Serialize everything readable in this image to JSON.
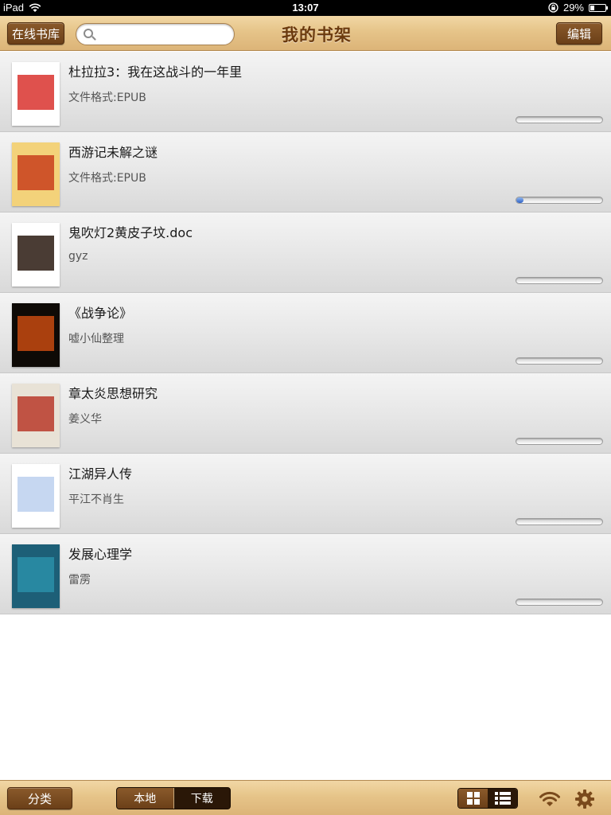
{
  "status": {
    "device": "iPad",
    "time": "13:07",
    "battery": "29%",
    "battery_level": 0.29
  },
  "header": {
    "online_library_label": "在线书库",
    "search_placeholder": "",
    "title": "我的书架",
    "edit_label": "编辑"
  },
  "books": [
    {
      "title": "杜拉拉3：我在这战斗的一年里",
      "subtitle": "文件格式:EPUB",
      "progress": 0.0,
      "cover_color": "#d9322e",
      "cover_bg": "#ffffff"
    },
    {
      "title": "西游记未解之谜",
      "subtitle": "文件格式:EPUB",
      "progress": 0.08,
      "cover_color": "#c8401c",
      "cover_bg": "#f3d27a"
    },
    {
      "title": "鬼吹灯2黄皮子坟.doc",
      "subtitle": "gyz",
      "progress": 0.0,
      "cover_color": "#2a1a10",
      "cover_bg": "#ffffff"
    },
    {
      "title": "《战争论》",
      "subtitle": "嘘小仙整理",
      "progress": 0.0,
      "cover_color": "#c64a10",
      "cover_bg": "#0e0a06"
    },
    {
      "title": "章太炎思想研究",
      "subtitle": "姜义华",
      "progress": 0.0,
      "cover_color": "#b83a2a",
      "cover_bg": "#e8e2d6"
    },
    {
      "title": "江湖异人传",
      "subtitle": "平江不肖生",
      "progress": 0.0,
      "cover_color": "#bcd0ee",
      "cover_bg": "#ffffff"
    },
    {
      "title": "发展心理学",
      "subtitle": "雷雳",
      "progress": 0.0,
      "cover_color": "#2a8fa8",
      "cover_bg": "#1d5f77"
    }
  ],
  "footer": {
    "category_label": "分类",
    "tabs": [
      {
        "label": "本地",
        "active": true
      },
      {
        "label": "下载",
        "active": false
      }
    ],
    "view_mode": "list"
  }
}
